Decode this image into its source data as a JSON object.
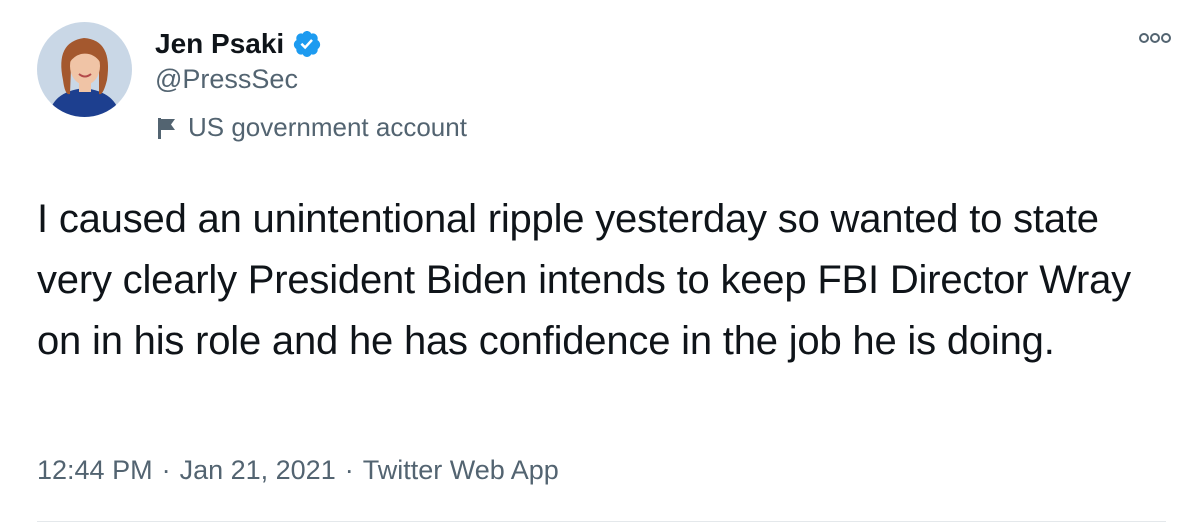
{
  "author": {
    "display_name": "Jen Psaki",
    "handle": "@PressSec",
    "verified": true,
    "account_label": "US government account",
    "avatar_icon": "profile-photo"
  },
  "tweet": {
    "text": "I caused an unintentional ripple yesterday so wanted to state very clearly President Biden intends to keep FBI Director Wray on in his role and he has confidence in the job he is doing."
  },
  "meta": {
    "time": "12:44 PM",
    "separator": "·",
    "date": "Jan 21, 2021",
    "source": "Twitter Web App"
  },
  "icons": {
    "verified": "verified-badge-icon",
    "flag": "flag-icon",
    "more": "more-options-icon"
  },
  "colors": {
    "verified_blue": "#1d9bf0",
    "secondary_text": "#536471",
    "primary_text": "#0f1419"
  }
}
